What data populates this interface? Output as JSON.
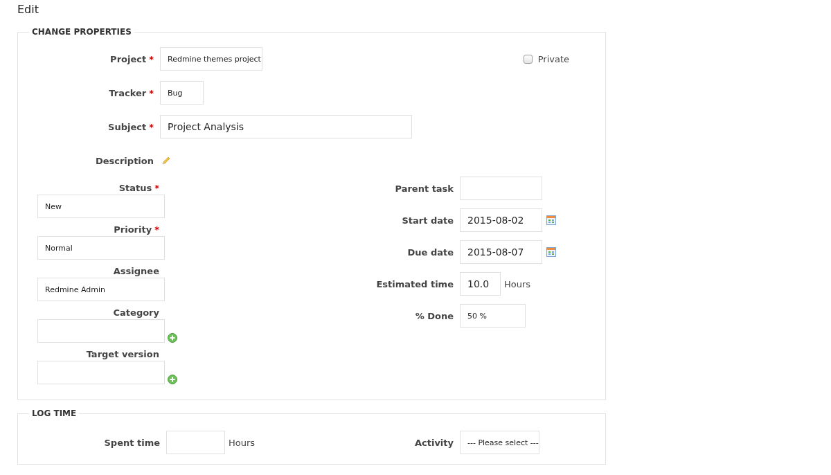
{
  "title": "Edit",
  "change_properties": {
    "legend": "CHANGE PROPERTIES",
    "top_rows": [
      {
        "kind": "select",
        "label": "Project",
        "required_mark": "*",
        "value": "Redmine themes project"
      },
      {
        "kind": "select",
        "label": "Tracker",
        "required_mark": "*",
        "value": "Bug"
      },
      {
        "kind": "text",
        "label": "Subject",
        "required_mark": "*",
        "value": "Project Analysis"
      },
      {
        "kind": "description",
        "label": "Description"
      }
    ],
    "private": {
      "label": "Private",
      "checked": false
    },
    "left_fields": [
      {
        "kind": "select",
        "label": "Status",
        "required_mark": "*",
        "value": "New"
      },
      {
        "kind": "select",
        "label": "Priority",
        "required_mark": "*",
        "value": "Normal"
      },
      {
        "kind": "select",
        "label": "Assignee",
        "value": "Redmine Admin"
      },
      {
        "kind": "select_with_add",
        "label": "Category"
      },
      {
        "kind": "select_with_add",
        "label": "Target version"
      }
    ],
    "right_fields": [
      {
        "kind": "text",
        "label": "Parent task"
      },
      {
        "kind": "date",
        "label": "Start date",
        "value": "2015-08-02"
      },
      {
        "kind": "date",
        "label": "Due date",
        "value": "2015-08-07"
      },
      {
        "kind": "hours",
        "label": "Estimated time",
        "value": "10.0",
        "unit": "Hours"
      },
      {
        "kind": "select",
        "label": "% Done",
        "value": "50 %"
      }
    ]
  },
  "log_time": {
    "legend": "LOG TIME",
    "spent_time": {
      "label": "Spent time",
      "unit": "Hours"
    },
    "activity": {
      "label": "Activity",
      "value": "--- Please select ---"
    }
  }
}
